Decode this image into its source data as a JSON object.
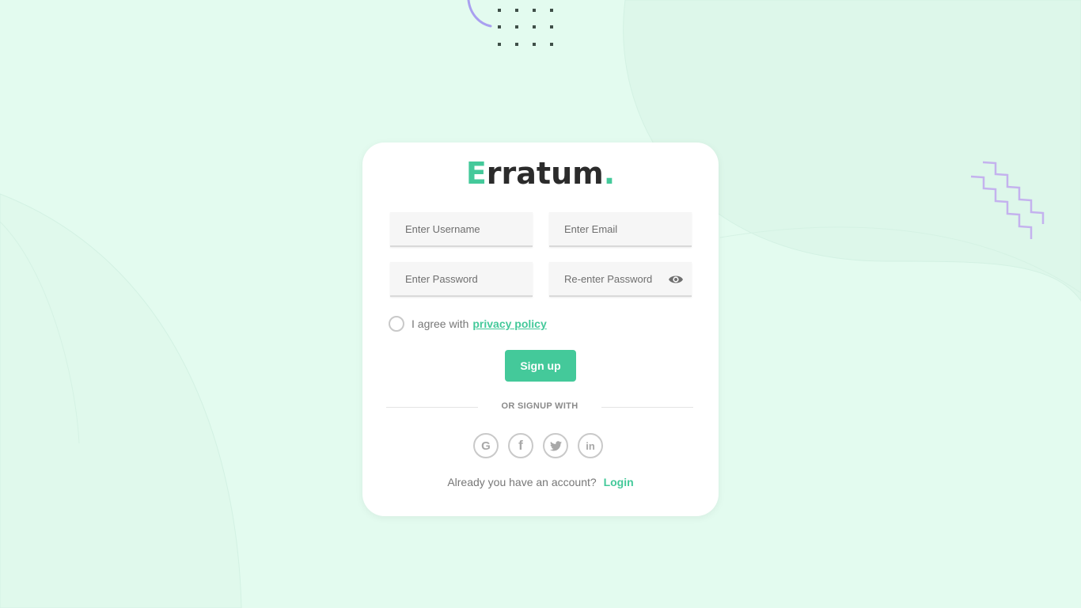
{
  "brand": {
    "logo_first_letter": "E",
    "logo_rest": "rratum",
    "logo_dot": ".",
    "accent_color": "#44c99a"
  },
  "form": {
    "username_placeholder": "Enter Username",
    "email_placeholder": "Enter Email",
    "password_placeholder": "Enter Password",
    "reenter_password_placeholder": "Re-enter Password",
    "agree_text": "I agree with",
    "privacy_link": "privacy policy",
    "signup_label": "Sign up"
  },
  "divider": {
    "text": "OR SIGNUP WITH"
  },
  "social": [
    {
      "icon": "google-icon",
      "glyph": "G"
    },
    {
      "icon": "facebook-icon",
      "glyph": "f"
    },
    {
      "icon": "twitter-icon"
    },
    {
      "icon": "linkedin-icon",
      "glyph": "in"
    }
  ],
  "footer": {
    "account_text": "Already you have an account?",
    "login_link": "Login"
  },
  "colors": {
    "background": "#e3fbef",
    "card": "#ffffff",
    "decor_purple": "#bdaef0",
    "decor_dots": "#3f4f48"
  }
}
